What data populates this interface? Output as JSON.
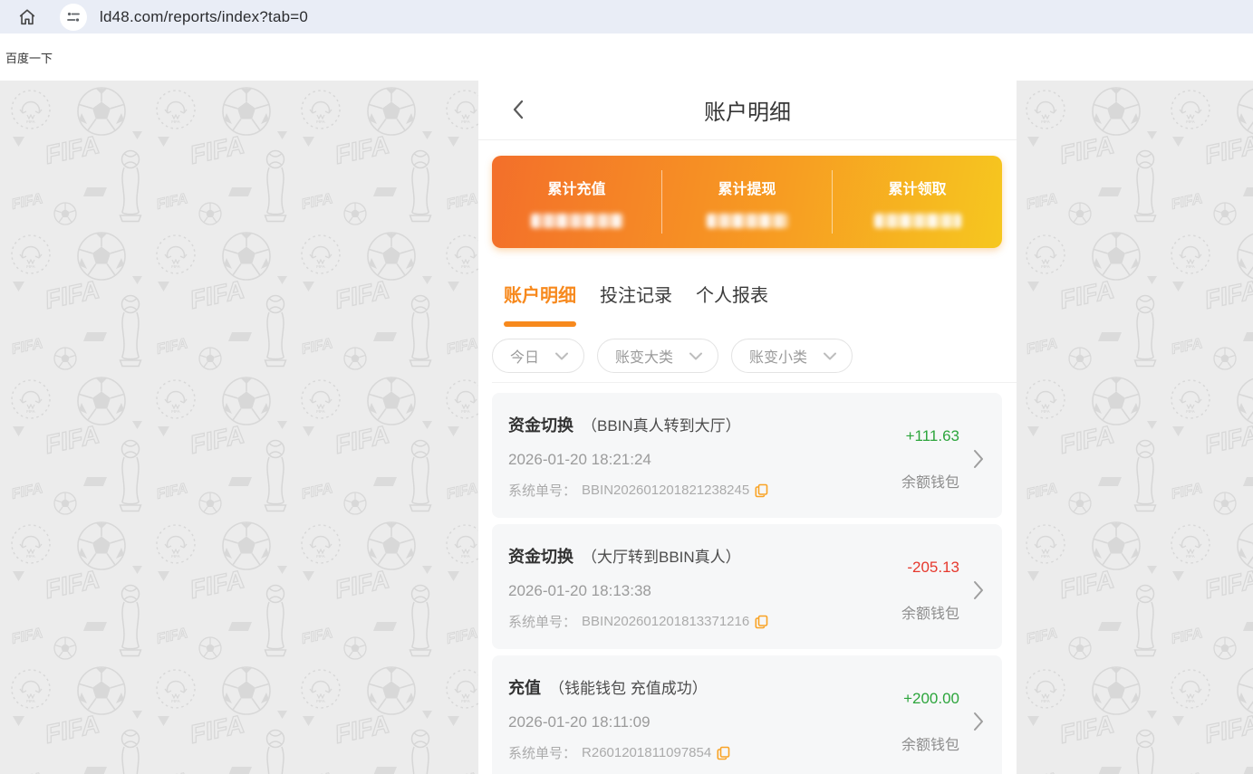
{
  "browser": {
    "url": "ld48.com/reports/index?tab=0",
    "bookmark": "百度一下"
  },
  "header": {
    "title": "账户明细"
  },
  "summary": {
    "items": [
      {
        "label": "累计充值",
        "value_hidden": true
      },
      {
        "label": "累计提现",
        "value_hidden": true
      },
      {
        "label": "累计领取",
        "value_hidden": true
      }
    ]
  },
  "tabs": [
    {
      "label": "账户明细",
      "active": true
    },
    {
      "label": "投注记录",
      "active": false
    },
    {
      "label": "个人报表",
      "active": false
    }
  ],
  "filters": [
    {
      "label": "今日"
    },
    {
      "label": "账变大类"
    },
    {
      "label": "账变小类"
    }
  ],
  "transactions": [
    {
      "type": "资金切换",
      "desc": "（BBIN真人转到大厅）",
      "datetime": "2026-01-20 18:21:24",
      "order_label": "系统单号：",
      "order_no": "BBIN202601201821238245",
      "amount": "+111.63",
      "direction": "in",
      "wallet": "余额钱包"
    },
    {
      "type": "资金切换",
      "desc": "（大厅转到BBIN真人）",
      "datetime": "2026-01-20 18:13:38",
      "order_label": "系统单号：",
      "order_no": "BBIN202601201813371216",
      "amount": "-205.13",
      "direction": "out",
      "wallet": "余额钱包"
    },
    {
      "type": "充值",
      "desc": "（钱能钱包 充值成功）",
      "datetime": "2026-01-20 18:11:09",
      "order_label": "系统单号：",
      "order_no": "R2601201811097854",
      "amount": "+200.00",
      "direction": "in",
      "wallet": "余额钱包"
    }
  ],
  "icons": {
    "home": "house-outline",
    "tune": "sliders",
    "back": "chevron-left",
    "dropdown": "chevron-down",
    "copy": "overlapping-pages",
    "row_arrow": "chevron-right"
  },
  "colors": {
    "positive": "#2ca53c",
    "negative": "#e6392e",
    "accent_orange": "#f7891d",
    "copy_icon": "#f9a325",
    "card_gradient_left": "#f36f2a",
    "card_gradient_right": "#f6c71f"
  }
}
